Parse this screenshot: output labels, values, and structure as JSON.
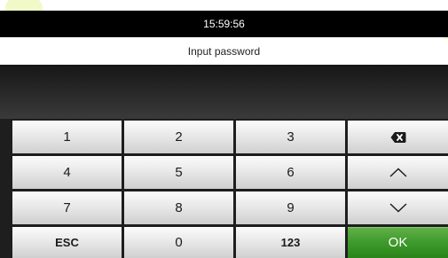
{
  "status": {
    "time": "15:59:56"
  },
  "prompt": {
    "text": "Input password"
  },
  "password": {
    "value": ""
  },
  "keypad": {
    "row1": [
      "1",
      "2",
      "3"
    ],
    "row2": [
      "4",
      "5",
      "6"
    ],
    "row3": [
      "7",
      "8",
      "9"
    ],
    "row4": {
      "esc": "ESC",
      "zero": "0",
      "mode": "123",
      "ok": "OK"
    },
    "icons": {
      "backspace": "backspace-icon",
      "up": "chevron-up-icon",
      "down": "chevron-down-icon"
    }
  },
  "colors": {
    "ok_button": "#3e9a2c",
    "status_bar": "#000000",
    "keypad_bg": "#1e1e1e"
  }
}
